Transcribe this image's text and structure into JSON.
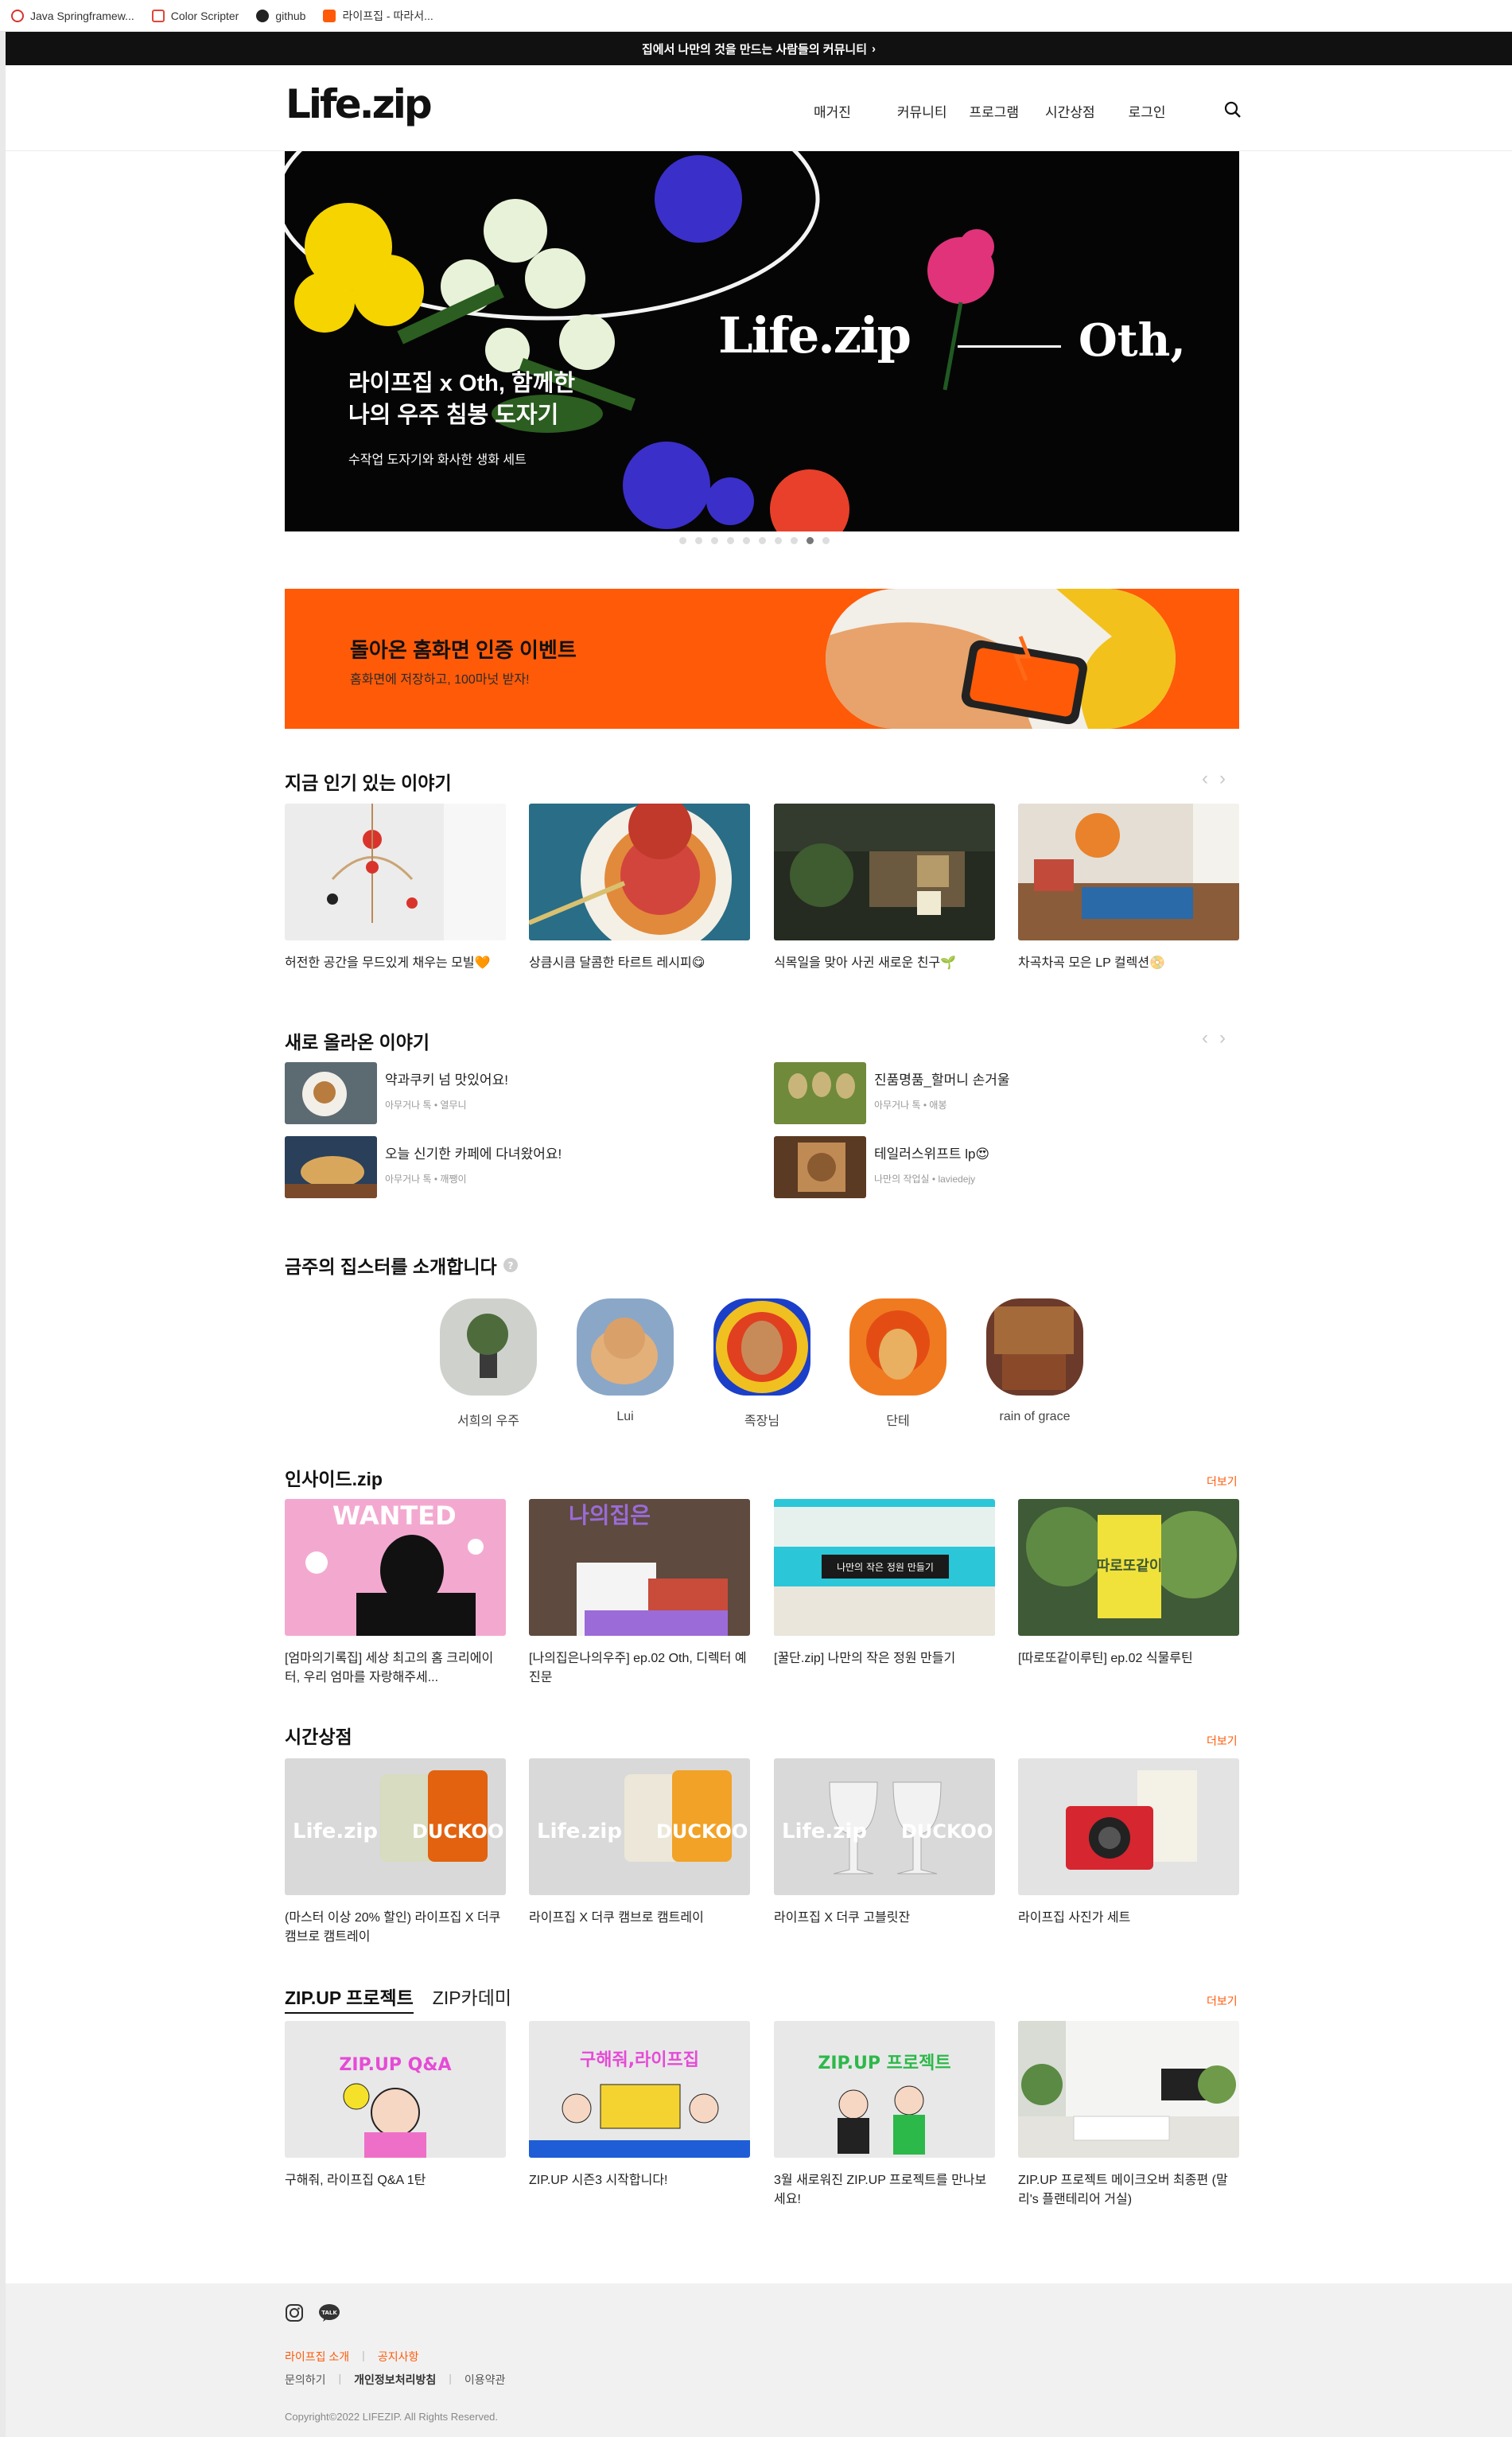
{
  "bookmarks": [
    {
      "label": "Java Springframew...",
      "color": "#d9342b",
      "icon": "circle-icon"
    },
    {
      "label": "Color Scripter",
      "color": "#e0463a",
      "icon": "square-icon"
    },
    {
      "label": "github",
      "color": "#222222",
      "icon": "github-icon"
    },
    {
      "label": "라이프집 - 따라서...",
      "color": "#ff5a08",
      "icon": "lifezip-icon"
    }
  ],
  "topbar": {
    "text": "집에서 나만의 것을 만드는 사람들의 커뮤니티",
    "arrow": "›"
  },
  "header": {
    "logo": "Life.zip",
    "nav": [
      "매거진",
      "커뮤니티",
      "프로그램",
      "시간상점",
      "로그인"
    ],
    "search_icon": "search-icon"
  },
  "hero": {
    "title": "라이프집 x Oth, 함께한\n나의 우주 침봉 도자기",
    "subtitle": "수작업 도자기와 화사한 생화 세트",
    "brand": "Life.zip",
    "partner": "Oth,",
    "dots": 10,
    "active_dot": 9
  },
  "promo": {
    "title": "돌아온 홈화면 인증 이벤트",
    "subtitle": "홈화면에 저장하고, 100마넛 받자!"
  },
  "popular": {
    "title": "지금 인기 있는 이야기",
    "items": [
      "허전한 공간을 무드있게 채우는 모빌🧡",
      "상큼시큼 달콤한 타르트 레시피😋",
      "식목일을 맞아 사귄 새로운 친구🌱",
      "차곡차곡 모은 LP 컬렉션📀"
    ]
  },
  "new_stories": {
    "title": "새로 올라온 이야기",
    "items": [
      {
        "title": "약과쿠키 넘 맛있어요!",
        "meta": "아무거나 톡 • 열무니"
      },
      {
        "title": "진품명품_할머니 손거울",
        "meta": "아무거나 톡 • 애봉"
      },
      {
        "title": "오늘 신기한 카페에 다녀왔어요!",
        "meta": "아무거나 톡 • 깨쨍이"
      },
      {
        "title": "테일러스위프트 lp😍",
        "meta": "나만의 작업실 • laviedejy"
      }
    ]
  },
  "zipsters": {
    "title": "금주의 집스터를 소개합니다",
    "help_icon": "question-icon",
    "people": [
      "서희의 우주",
      "Lui",
      "족장님",
      "단테",
      "rain of grace"
    ]
  },
  "inside": {
    "title": "인사이드.zip",
    "more": "더보기",
    "items": [
      "[엄마의기록집] 세상 최고의 홈 크리에이터, 우리 엄마를 자랑해주세...",
      "[나의집은나의우주] ep.02 Oth, 디렉터 예진문",
      "[꿀단.zip] 나만의 작은 정원 만들기",
      "[따로또같이루틴] ep.02 식물루틴"
    ],
    "thumb_texts": [
      "WANTED",
      "나의집은",
      "나만의 작은 정원 만들기",
      "따로또같이"
    ]
  },
  "shop": {
    "title": "시간상점",
    "more": "더보기",
    "items": [
      "(마스터 이상 20% 할인) 라이프집 X 더쿠 캠브로 캠트레이",
      "라이프집 X 더쿠 캠브로 캠트레이",
      "라이프집 X 더쿠 고블릿잔",
      "라이프집 사진가 세트"
    ],
    "thumb_brand": "Life.zip",
    "thumb_partner": "DUCKOO"
  },
  "zipup": {
    "tabs": [
      "ZIP.UP 프로젝트",
      "ZIP카데미"
    ],
    "more": "더보기",
    "items": [
      "구해줘, 라이프집 Q&A 1탄",
      "ZIP.UP 시즌3 시작합니다!",
      "3월 새로워진 ZIP.UP 프로젝트를 만나보세요!",
      "ZIP.UP 프로젝트 메이크오버 최종편 (말리's 플랜테리어 거실)"
    ],
    "thumb_texts": [
      "ZIP.UP Q&A",
      "구해줘,라이프집",
      "ZIP.UP 프로젝트",
      ""
    ]
  },
  "footer": {
    "icons": [
      "instagram-icon",
      "kakaotalk-icon"
    ],
    "talk_label": "TALK",
    "links_primary": [
      "라이프집 소개",
      "공지사항"
    ],
    "links_secondary": [
      "문의하기",
      "개인정보처리방침",
      "이용약관"
    ],
    "copyright": "Copyright©2022 LIFEZIP. All Rights Reserved."
  },
  "colors": {
    "accent": "#ff5a08",
    "dark": "#111111"
  }
}
